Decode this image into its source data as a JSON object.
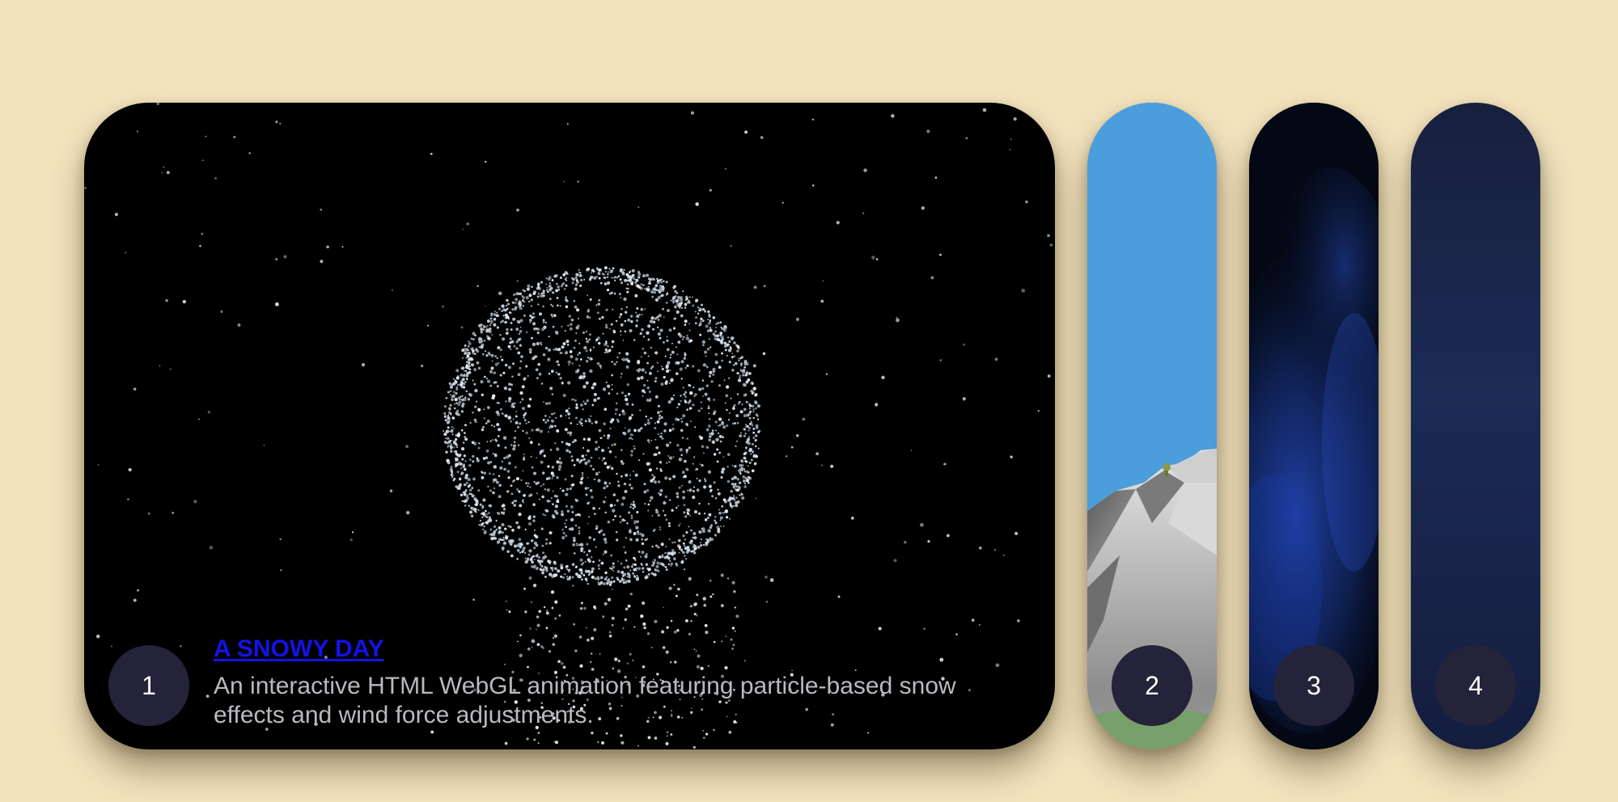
{
  "cards": [
    {
      "number": "1",
      "title": "A SNOWY DAY",
      "description": "An interactive HTML WebGL animation featuring particle-based snow effects and wind force adjustments.",
      "expanded": true
    },
    {
      "number": "2",
      "expanded": false
    },
    {
      "number": "3",
      "expanded": false
    },
    {
      "number": "4",
      "expanded": false
    }
  ],
  "colors": {
    "page_background": "#f2e3bd",
    "badge_background": "#25233a",
    "title_link": "#1313e6",
    "description_text": "#b9b9c0"
  }
}
